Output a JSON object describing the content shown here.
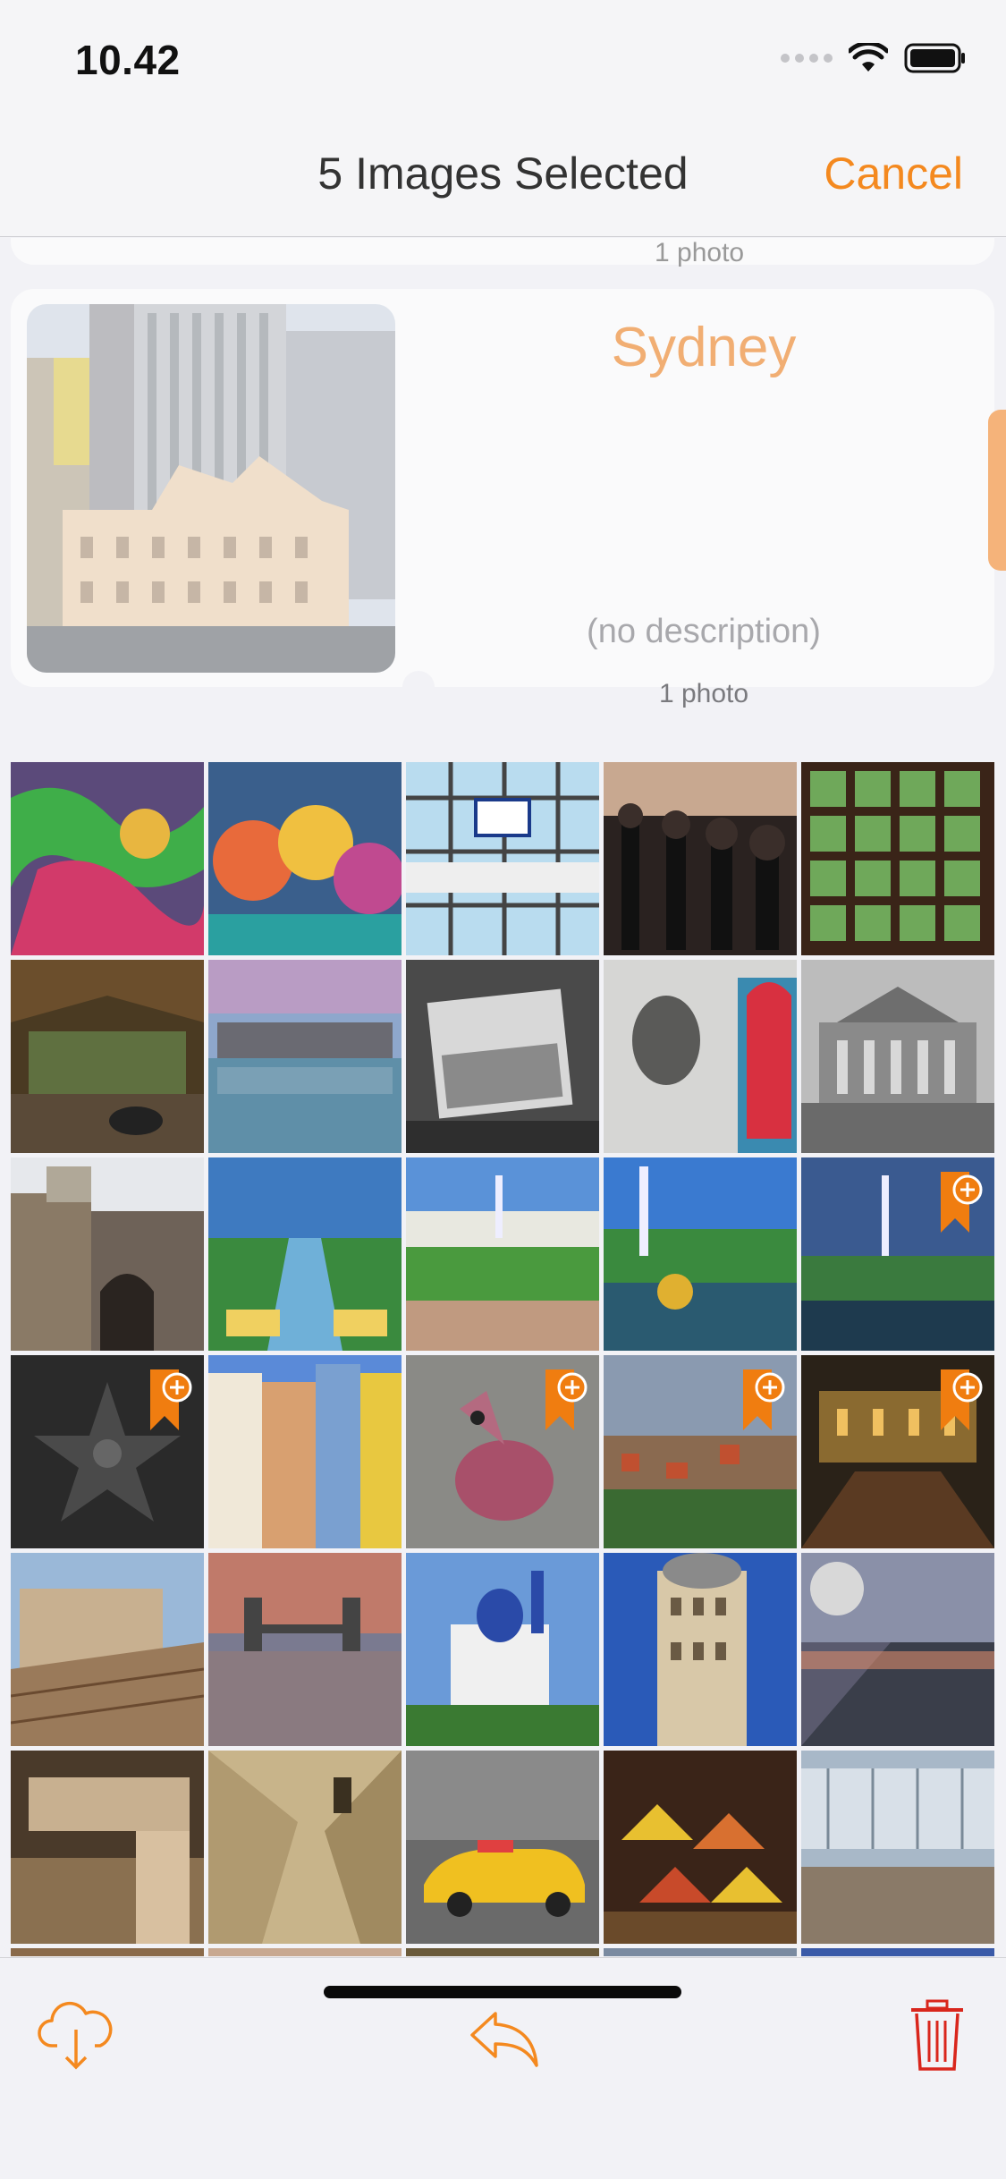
{
  "status_bar": {
    "time": "10.42"
  },
  "nav": {
    "title": "5 Images Selected",
    "cancel_label": "Cancel"
  },
  "albums": {
    "previous": {
      "count": "1 photo"
    },
    "current": {
      "title": "Sydney",
      "description": "(no description)",
      "count": "1 photo"
    }
  },
  "colors": {
    "accent": "#f4891f",
    "delete": "#d9261c",
    "badge": "#f07d10"
  },
  "grid": {
    "columns": 5,
    "items": [
      {
        "name": "street-art-mural",
        "selected": false
      },
      {
        "name": "graffiti-faces-wall",
        "selected": false
      },
      {
        "name": "db-hauptbahnhof-sign",
        "selected": false
      },
      {
        "name": "iron-railing-finials",
        "selected": false
      },
      {
        "name": "pottery-shelves-window",
        "selected": false
      },
      {
        "name": "abandoned-room",
        "selected": false
      },
      {
        "name": "lake-sunset-dam",
        "selected": false
      },
      {
        "name": "window-in-ruin",
        "selected": false
      },
      {
        "name": "portrait-drawing-red-door",
        "selected": false
      },
      {
        "name": "neoclassical-building-bw",
        "selected": false
      },
      {
        "name": "stone-tower-gate",
        "selected": false
      },
      {
        "name": "palace-canal-fountains",
        "selected": false
      },
      {
        "name": "palace-garden-fountain",
        "selected": false
      },
      {
        "name": "golden-fountain-pond",
        "selected": false
      },
      {
        "name": "fountain-park-evening",
        "selected": true
      },
      {
        "name": "walk-of-fame-star",
        "selected": true
      },
      {
        "name": "half-timbered-houses",
        "selected": false
      },
      {
        "name": "bird-graffiti",
        "selected": true
      },
      {
        "name": "city-panorama-clouds",
        "selected": true
      },
      {
        "name": "night-plaza",
        "selected": true
      },
      {
        "name": "old-town-rooftops",
        "selected": false
      },
      {
        "name": "bridge-reflection-dusk",
        "selected": false
      },
      {
        "name": "blue-dome-church",
        "selected": false
      },
      {
        "name": "parisian-corner-building",
        "selected": false
      },
      {
        "name": "waterfront-promenade",
        "selected": false
      },
      {
        "name": "sepia-interior-stairs",
        "selected": false
      },
      {
        "name": "stone-spiral-stairs",
        "selected": false
      },
      {
        "name": "yellow-taxi-motion",
        "selected": false
      },
      {
        "name": "spice-market-stall",
        "selected": false
      },
      {
        "name": "glass-building-courtyard",
        "selected": false
      },
      {
        "name": "partial-row-1",
        "selected": false
      },
      {
        "name": "partial-row-2",
        "selected": false
      },
      {
        "name": "partial-row-3",
        "selected": false
      },
      {
        "name": "partial-row-4",
        "selected": false
      },
      {
        "name": "partial-row-5",
        "selected": false
      }
    ]
  },
  "toolbar": {
    "download_icon": "cloud-download-icon",
    "share_icon": "reply-share-icon",
    "delete_icon": "trash-icon"
  }
}
